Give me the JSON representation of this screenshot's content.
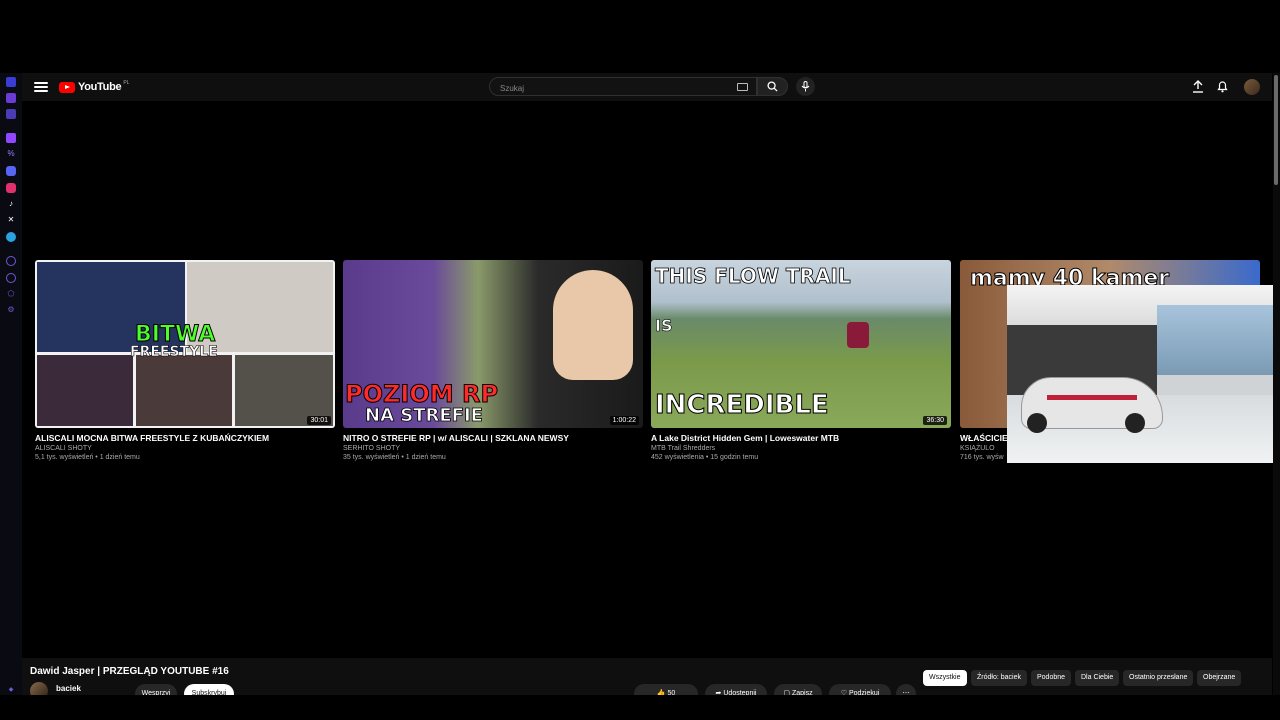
{
  "header": {
    "logo_text": "YouTube",
    "logo_country": "PL",
    "search_placeholder": "Szukaj"
  },
  "videos": [
    {
      "title": "ALISCALI MOCNA BITWA FREESTYLE Z KUBAŃCZYKIEM",
      "channel": "ALISCALI SHOTY",
      "meta": "5,1 tys. wyświetleń • 1 dzień temu",
      "duration": "30:01",
      "thumb_line1": "BITWA",
      "thumb_line2": "FREESTYLE"
    },
    {
      "title": "NITRO O STREFIE RP | w/ ALISCALI | SZKLANA NEWSY",
      "channel": "SERHITO SHOTY",
      "meta": "35 tys. wyświetleń • 1 dzień temu",
      "duration": "1:00:22",
      "thumb_line1": "POZIOM RP",
      "thumb_line2": "NA STREFIE"
    },
    {
      "title": "A Lake District Hidden Gem | Loweswater MTB",
      "channel": "MTB Trail Shredders",
      "meta": "452 wyświetlenia • 15 godzin temu",
      "duration": "36:30",
      "thumb_line1": "THIS FLOW TRAIL",
      "thumb_line2": "IS",
      "thumb_line3": "INCREDIBLE"
    },
    {
      "title": "WŁAŚCICIEL",
      "channel": "KSIĄŻULO",
      "meta": "716 tys. wyśw",
      "thumb_line1": "mamy 40 kamer"
    }
  ],
  "bottom": {
    "video_title": "Dawid Jasper | PRZEGLĄD YOUTUBE #16",
    "channel_name": "baciek",
    "support_label": "Wesprzyj",
    "subscribe_label": "Subskrybuj",
    "likes": "50",
    "share_label": "Udostępnij",
    "save_label": "Zapisz",
    "remix_label": "Podziękuj",
    "chips": [
      "Wszystkie",
      "Źródło: baciek",
      "Podobne",
      "Dla Ciebie",
      "Ostatnio przesłane",
      "Obejrzane"
    ]
  },
  "colors": {
    "accent_red": "#ff0000",
    "header_bg": "#0f0f0f",
    "main_bg": "#000000"
  }
}
